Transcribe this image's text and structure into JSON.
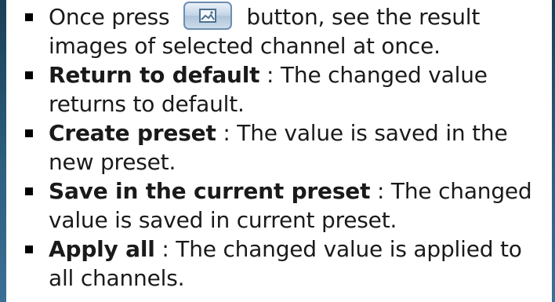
{
  "items": [
    {
      "pre": "Once press",
      "icon": "image-icon",
      "post": "button, see the result images of selected channel at once."
    },
    {
      "term": "Return to default",
      "desc": " : The changed value returns to default."
    },
    {
      "term": "Create preset",
      "desc": " : The value is saved in the new preset."
    },
    {
      "term": "Save in the current preset",
      "desc": " : The changed value is saved in current preset."
    },
    {
      "term": "Apply all",
      "desc": " : The changed value is applied to all channels."
    }
  ],
  "colors": {
    "text": "#1a1a1a",
    "edge": "#2d5f7f",
    "button_border": "#6a8fb0",
    "button_fill": "#c3d4e6"
  }
}
